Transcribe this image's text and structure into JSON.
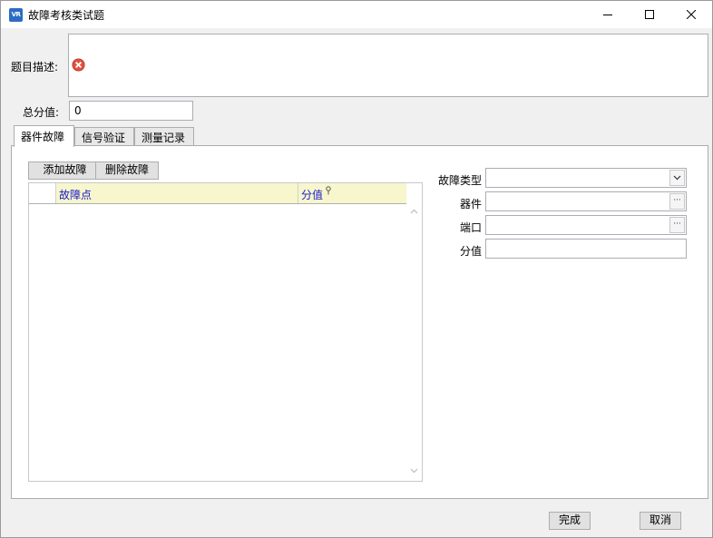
{
  "window": {
    "title": "故障考核类试题",
    "icon_text": "VR",
    "accent": "#2b6cc4"
  },
  "description": {
    "label": "题目描述:",
    "value": ""
  },
  "score": {
    "label": "总分值:",
    "value": "0"
  },
  "tabs": [
    {
      "label": "器件故障",
      "active": true
    },
    {
      "label": "信号验证",
      "active": false
    },
    {
      "label": "测量记录",
      "active": false
    }
  ],
  "fault_panel": {
    "add_label": "添加故障",
    "delete_label": "删除故障",
    "columns": [
      "故障点",
      "分值"
    ],
    "rows": []
  },
  "form": {
    "fault_type_label": "故障类型",
    "fault_type_value": "",
    "device_label": "器件",
    "device_value": "",
    "port_label": "端口",
    "port_value": "",
    "score_label": "分值",
    "score_value": ""
  },
  "footer": {
    "ok_label": "完成",
    "cancel_label": "取消"
  }
}
